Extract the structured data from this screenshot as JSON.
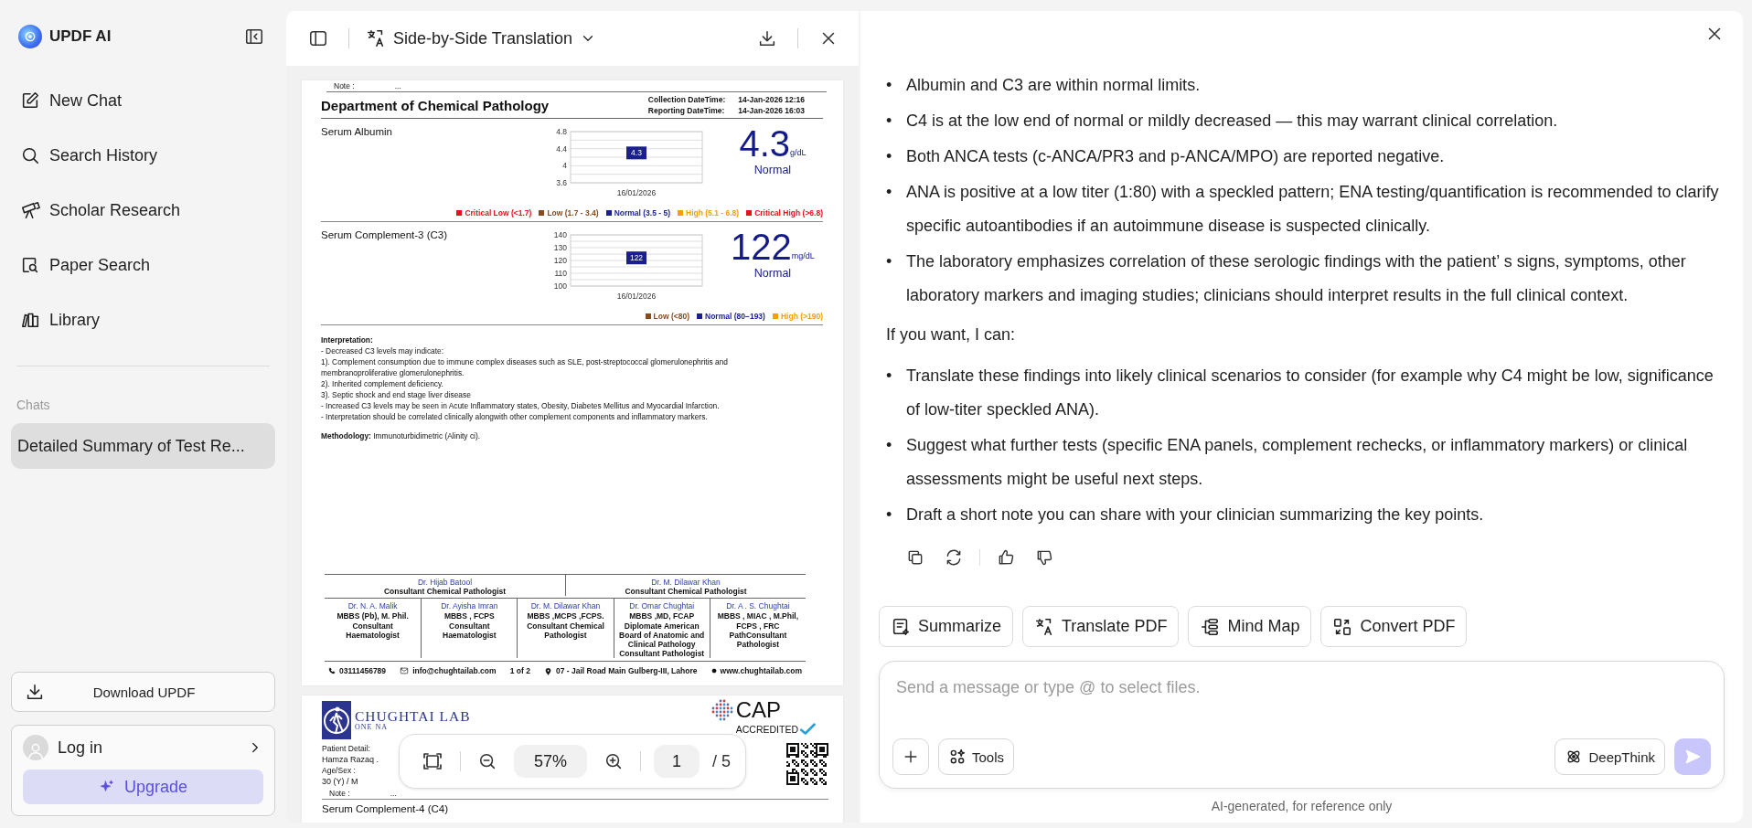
{
  "sidebar": {
    "brand": "UPDF AI",
    "nav": [
      {
        "label": "New Chat"
      },
      {
        "label": "Search History"
      },
      {
        "label": "Scholar Research"
      },
      {
        "label": "Paper Search"
      },
      {
        "label": "Library"
      }
    ],
    "section_label": "Chats",
    "chats": [
      {
        "title": "Detailed Summary of Test Re...",
        "selected": true
      }
    ],
    "download_button": "Download UPDF",
    "login": "Log in",
    "upgrade_button": "Upgrade"
  },
  "pdf_viewer": {
    "mode": "Side-by-Side Translation",
    "report_page": {
      "note_label": "Note :",
      "note_value": "...",
      "department": "Department of Chemical Pathology",
      "dates": [
        {
          "label": "Collection DateTime:",
          "value": "14-Jan-2026 12:16"
        },
        {
          "label": "Reporting DateTime:",
          "value": "14-Jan-2026 16:03"
        }
      ],
      "tests": [
        {
          "name": "Serum Albumin",
          "result": "4.3",
          "unit": "g/dL",
          "status": "Normal",
          "chart_data": {
            "type": "scatter",
            "categories": [
              "16/01/2026"
            ],
            "grid": true,
            "series": [
              {
                "color": "#1a1f8c",
                "values": [
                  4.3
                ]
              }
            ],
            "ylim": [
              3.6,
              4.8
            ],
            "yticks": [
              3.6,
              4,
              4.4,
              4.8
            ],
            "data_labels": true
          },
          "legend": [
            {
              "label": "Critical Low (<1.7)",
              "color": "#e8111b"
            },
            {
              "label": "Low (1.7 - 3.4)",
              "color": "#8b4a1c"
            },
            {
              "label": "Normal (3.5 - 5)",
              "color": "#1a1f8c"
            },
            {
              "label": "High (5.1 - 6.8)",
              "color": "#f5a000"
            },
            {
              "label": "Critical High (>6.8)",
              "color": "#e8111b"
            }
          ]
        },
        {
          "name": "Serum Complement-3 (C3)",
          "result": "122",
          "unit": "mg/dL",
          "status": "Normal",
          "chart_data": {
            "type": "scatter",
            "categories": [
              "16/01/2026"
            ],
            "grid": true,
            "series": [
              {
                "color": "#1a1f8c",
                "values": [
                  122
                ]
              }
            ],
            "ylim": [
              100,
              140
            ],
            "yticks": [
              100,
              110,
              120,
              130,
              140
            ],
            "data_labels": true
          },
          "legend": [
            {
              "label": "Low (<80)",
              "color": "#8b4a1c"
            },
            {
              "label": "Normal (80−193)",
              "color": "#1a1f8c"
            },
            {
              "label": "High (>190)",
              "color": "#f5a000"
            }
          ]
        }
      ],
      "interpretation_title": "Interpretation:",
      "interpretation_lines": [
        "- Decreased C3 levels may indicate:",
        "1). Complement consumption due to immune complex diseases such as SLE, post-streptococcal glomerulonephritis and membranoproliferative glomerulonephritis.",
        "2). Inherited complement deficiency.",
        "3). Septic shock and end stage liver disease",
        "- Increased C3 levels may be seen in Acute Inflammatory states, Obesity, Diabetes Mellitus and Myocardial Infarction.",
        "- Interpretation should be correlated clinically alongwith other complement components and inflammatory markers."
      ],
      "methodology": "**Methodology:** Immunoturbidimetric (Alinity ci).",
      "signatories_top": [
        {
          "name": "Dr. Hijab Batool",
          "title": "Consultant Chemical Pathologist"
        },
        {
          "name": "Dr. M. Dilawar Khan",
          "title": "Consultant Chemical Pathologist"
        }
      ],
      "signatories": [
        {
          "name": "Dr. N. A. Malik",
          "degrees": "MBBS (Pb), M. Phil.",
          "title": "Consultant Haematologist"
        },
        {
          "name": "Dr. Ayisha Imran",
          "degrees": "MBBS , FCPS",
          "title": "Consultant Haematologist"
        },
        {
          "name": "Dr. M. Dilawar Khan",
          "degrees": "MBBS ,MCPS ,FCPS.",
          "title": "Consultant Chemical Pathologist"
        },
        {
          "name": "Dr. Omar Chughtai",
          "degrees": "MBBS ,MD, FCAP",
          "title": "Diplomate American Board of Anatomic and Clinical Pathology Consultant Pathologist"
        },
        {
          "name": "Dr. A . S. Chughtai",
          "degrees": "MBBS , MIAC , M.Phil,",
          "title": "FCPS , FRC PathConsultant Pathologist"
        }
      ],
      "footer": {
        "phone": "03111456789",
        "email": "info@chughtailab.com",
        "page": "1 of 2",
        "address": "07 - Jail Road Main Gulberg-III, Lahore",
        "website": "www.chughtailab.com"
      }
    },
    "next_page": {
      "brand": "CHUGHTAI LAB",
      "tagline": "ONE NA",
      "accreditation": "CAP",
      "accreditation_sub": "ACCREDITED",
      "patient_label": "Patient Detail:",
      "patient_name": "Hamza Razaq .",
      "age_label": "Age/Sex :",
      "age_value": "30 (Y) / M",
      "note_label": "Note :",
      "note_value": "...",
      "test_name": "Serum Complement-4  (C4)"
    },
    "zoom_bar": {
      "zoom": "57%",
      "page": "1",
      "page_total": "/ 5"
    }
  },
  "chat": {
    "response": [
      {
        "kind": "bullets",
        "marker": "•",
        "items": [
          "Albumin and C3 are within normal limits.",
          "C4 is at the low end of normal or mildly decreased — this may warrant clinical correlation.",
          "Both ANCA tests (c-ANCA/PR3 and p-ANCA/MPO) are reported negative.",
          "ANA is positive at a low titer (1:80) with a speckled pattern; ENA testing/quantification is recommended to clarify specific autoantibodies if an autoimmune disease is suspected clinically.",
          "The laboratory emphasizes correlation of these serologic findings with the patient’ s signs, symptoms, other laboratory markers and imaging studies; clinicians should interpret results in the full clinical context."
        ]
      },
      {
        "kind": "paragraph",
        "text": "If you want, I can:"
      },
      {
        "kind": "bullets",
        "marker": "•",
        "items": [
          "Translate these findings into likely clinical scenarios to consider (for example why C4 might be low, significance of low-titer speckled ANA).",
          "Suggest what further tests (specific ENA panels, complement rechecks, or inflammatory markers) or clinical assessments might be useful next steps.",
          "Draft a short note you can share with your clinician summarizing the key points."
        ]
      }
    ],
    "quick_actions": [
      "Summarize",
      "Translate PDF",
      "Mind Map",
      "Convert PDF"
    ],
    "composer": {
      "placeholder": "Send a message or type @ to select files.",
      "tools_button": "Tools",
      "deepthink_button": "DeepThink"
    },
    "disclaimer": "AI-generated, for reference only"
  }
}
